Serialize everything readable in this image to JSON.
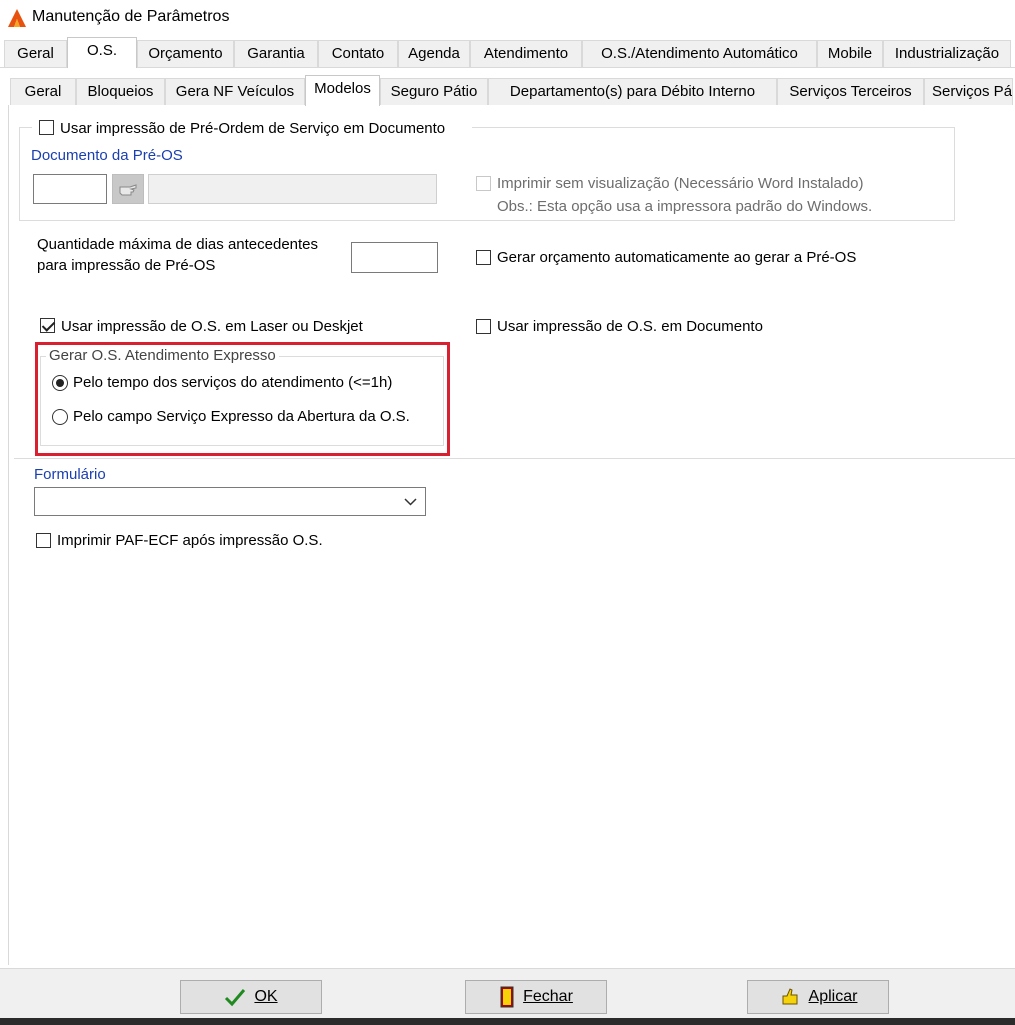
{
  "window": {
    "title": "Manutenção de Parâmetros"
  },
  "tabs_main": [
    {
      "label": "Geral"
    },
    {
      "label": "O.S."
    },
    {
      "label": "Orçamento"
    },
    {
      "label": "Garantia"
    },
    {
      "label": "Contato"
    },
    {
      "label": "Agenda"
    },
    {
      "label": "Atendimento"
    },
    {
      "label": "O.S./Atendimento Automático"
    },
    {
      "label": "Mobile"
    },
    {
      "label": "Industrialização"
    }
  ],
  "tabs_sub": [
    {
      "label": "Geral"
    },
    {
      "label": "Bloqueios"
    },
    {
      "label": "Gera NF Veículos"
    },
    {
      "label": "Modelos"
    },
    {
      "label": "Seguro Pátio"
    },
    {
      "label": "Departamento(s) para Débito Interno"
    },
    {
      "label": "Serviços Terceiros"
    },
    {
      "label": "Serviços Pá"
    }
  ],
  "pre_os": {
    "use_label": "Usar impressão de Pré-Ordem de Serviço em Documento",
    "doc_label": "Documento da Pré-OS",
    "print_no_preview_label": "Imprimir sem visualização (Necessário Word Instalado)",
    "obs_label": "Obs.: Esta opção usa a impressora padrão do Windows."
  },
  "max_days": {
    "line1": "Quantidade máxima de dias antecedentes",
    "line2": "para impressão de Pré-OS",
    "value": ""
  },
  "gen_budget_label": "Gerar orçamento automaticamente ao gerar a Pré-OS",
  "use_laser_label": "Usar impressão de O.S. em Laser ou Deskjet",
  "use_doc_label": "Usar impressão de O.S. em Documento",
  "express": {
    "group_label": "Gerar O.S. Atendimento Expresso",
    "option1": "Pelo tempo dos serviços do atendimento (<=1h)",
    "option2": "Pelo campo Serviço Expresso da Abertura da O.S."
  },
  "form": {
    "label": "Formulário",
    "value": ""
  },
  "paf_label": "Imprimir PAF-ECF após impressão O.S.",
  "buttons": {
    "ok": "OK",
    "close": "Fechar",
    "apply": "Aplicar"
  },
  "colors": {
    "highlight": "#d92030",
    "label_blue": "#1a3fb0"
  }
}
